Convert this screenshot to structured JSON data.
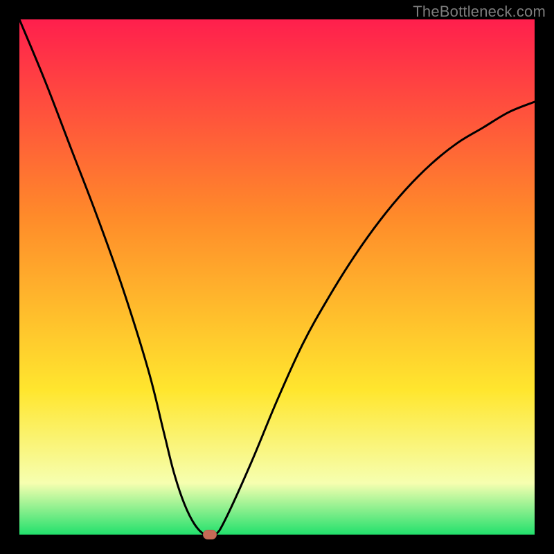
{
  "watermark": "TheBottleneck.com",
  "colors": {
    "bg": "#000000",
    "watermark": "#7d7d7d",
    "curve": "#000000",
    "marker": "#c66a56",
    "grad_top": "#ff1f4d",
    "grad_mid1": "#ff8a2a",
    "grad_mid2": "#ffe62e",
    "grad_low": "#f6ffb0",
    "grad_bottom": "#22e06c"
  },
  "chart_data": {
    "type": "line",
    "title": "",
    "xlabel": "",
    "ylabel": "",
    "xlim": [
      0,
      100
    ],
    "ylim": [
      0,
      100
    ],
    "grid": false,
    "legend": false,
    "series": [
      {
        "name": "bottleneck-curve",
        "x": [
          0,
          5,
          10,
          15,
          20,
          25,
          28,
          30,
          32,
          34,
          36,
          38,
          40,
          45,
          50,
          55,
          60,
          65,
          70,
          75,
          80,
          85,
          90,
          95,
          100
        ],
        "y": [
          100,
          88,
          75,
          62,
          48,
          32,
          20,
          12,
          6,
          2,
          0,
          0,
          3,
          14,
          26,
          37,
          46,
          54,
          61,
          67,
          72,
          76,
          79,
          82,
          84
        ]
      }
    ],
    "markers": [
      {
        "name": "optimal-point",
        "x": 37,
        "y": 0
      }
    ],
    "gradient_stops": [
      {
        "pos": 0.0,
        "color": "#ff1f4d"
      },
      {
        "pos": 0.38,
        "color": "#ff8a2a"
      },
      {
        "pos": 0.72,
        "color": "#ffe62e"
      },
      {
        "pos": 0.9,
        "color": "#f6ffb0"
      },
      {
        "pos": 1.0,
        "color": "#22e06c"
      }
    ]
  }
}
